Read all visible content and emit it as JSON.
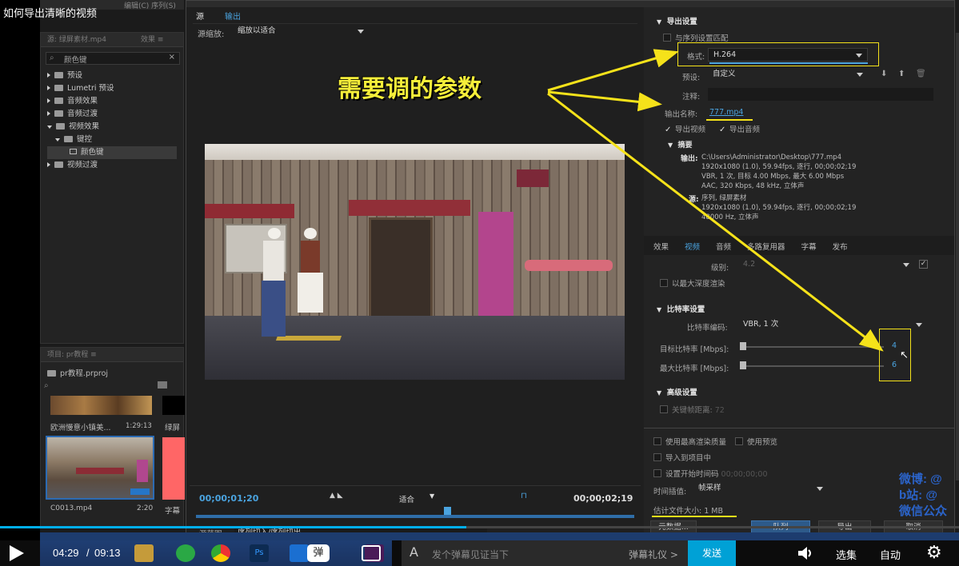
{
  "video_title": "如何导出清晰的视频",
  "premiere": {
    "menu_fragment": "编辑(C)   序列(S)",
    "effects_panel": {
      "tab_label": "源: 绿屏素材.mp4",
      "tab2_label": "效果  ≡",
      "search_value": "颜色键",
      "tree": [
        "预设",
        "Lumetri 预设",
        "音频效果",
        "音频过渡",
        "视频效果",
        "键控",
        "颜色键",
        "视频过渡"
      ]
    },
    "project_panel": {
      "tab_label": "项目: pr教程  ≡",
      "file_name": "pr教程.prproj",
      "clips": [
        {
          "name": "欧洲慢意小镇美...",
          "duration": "1:29:13"
        },
        {
          "name": "绿屏",
          "duration": ""
        },
        {
          "name": "C0013.mp4",
          "duration": "2:20"
        },
        {
          "name": "字幕",
          "duration": ""
        }
      ]
    }
  },
  "export_dialog": {
    "tabs": [
      "源",
      "输出"
    ],
    "source_scaling_label": "源缩放:",
    "source_scaling_value": "缩放以适合",
    "timecode_current": "00;00;01;20",
    "timecode_end": "00;00;02;19",
    "fit_value": "适合",
    "source_range_label": "源范围:",
    "source_range_value": "序列切入/序列切出",
    "export_settings": {
      "header": "导出设置",
      "match_sequence": "与序列设置匹配",
      "format_label": "格式:",
      "format_value": "H.264",
      "preset_label": "预设:",
      "preset_value": "自定义",
      "comment_label": "注释:",
      "output_name_label": "输出名称:",
      "output_name_value": "777.mp4",
      "export_video": "导出视频",
      "export_audio": "导出音频",
      "summary_header": "摘要",
      "output_label": "输出:",
      "output_lines": [
        "C:\\Users\\Administrator\\Desktop\\777.mp4",
        "1920x1080 (1.0), 59.94fps, 逐行, 00;00;02;19",
        "VBR, 1 次, 目标 4.00 Mbps, 最大 6.00 Mbps",
        "AAC, 320 Kbps, 48 kHz, 立体声"
      ],
      "source_label": "源:",
      "source_lines": [
        "序列, 绿屏素材",
        "1920x1080 (1.0), 59.94fps, 逐行, 00;00;02;19",
        "48000 Hz, 立体声"
      ]
    },
    "settings_tabs": [
      "效果",
      "视频",
      "音频",
      "多路复用器",
      "字幕",
      "发布"
    ],
    "level_label": "级别:",
    "level_value": "4.2",
    "max_depth": "以最大深度渲染",
    "bitrate_header": "比特率设置",
    "bitrate_encoding_label": "比特率编码:",
    "bitrate_encoding_value": "VBR, 1 次",
    "target_bitrate_label": "目标比特率 [Mbps]:",
    "target_bitrate_value": "4",
    "max_bitrate_label": "最大比特率 [Mbps]:",
    "max_bitrate_value": "6",
    "advanced_header": "高级设置",
    "keyframe_label": "关键帧距离:",
    "keyframe_value": "72",
    "max_render_quality": "使用最高渲染质量",
    "use_previews": "使用预览",
    "import_project": "导入到项目中",
    "set_start_tc": "设置开始时间码",
    "start_tc_value": "00;00;00;00",
    "time_interp_label": "时间插值:",
    "time_interp_value": "帧采样",
    "est_size_label": "估计文件大小:",
    "est_size_value": "1 MB",
    "buttons": {
      "metadata": "元数据...",
      "queue": "队列",
      "export": "导出",
      "cancel": "取消"
    }
  },
  "annotation_text": "需要调的参数",
  "watermark": [
    "微博: @",
    "b站: @",
    "微信公众"
  ],
  "player": {
    "current_time": "04:29",
    "separator": "/",
    "total_time": "09:13",
    "danmaku_label": "弹",
    "danmaku_placeholder": "发个弹幕见证当下",
    "danmaku_etiquette": "弹幕礼仪 >",
    "send": "发送",
    "episodes": "选集",
    "auto": "自动",
    "progress_fraction": 0.486
  }
}
